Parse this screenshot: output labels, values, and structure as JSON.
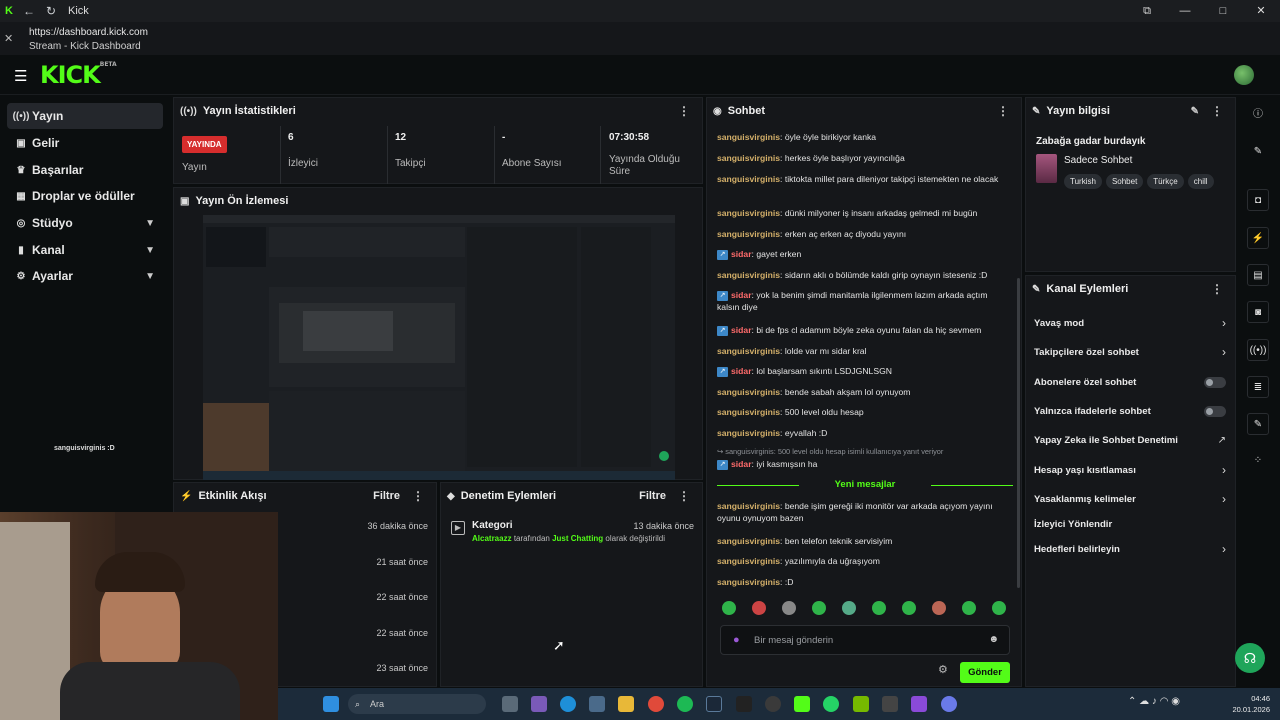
{
  "browser": {
    "tab_title": "Kick",
    "url": "https://dashboard.kick.com",
    "page_title": "Stream - Kick Dashboard"
  },
  "app": {
    "logo": "KICK",
    "logo_sup": "BETA"
  },
  "sidebar": {
    "items": [
      {
        "label": "Yayın",
        "icon": "broadcast-icon",
        "active": true
      },
      {
        "label": "Gelir",
        "icon": "money-icon"
      },
      {
        "label": "Başarılar",
        "icon": "trophy-icon"
      },
      {
        "label": "Droplar ve ödüller",
        "icon": "gift-icon"
      },
      {
        "label": "Stüdyo",
        "icon": "studio-icon",
        "expandable": true
      },
      {
        "label": "Kanal",
        "icon": "channel-icon",
        "expandable": true
      },
      {
        "label": "Ayarlar",
        "icon": "gear-icon",
        "expandable": true
      }
    ]
  },
  "overlay_text": "sanguisvirginis :D",
  "stats": {
    "title": "Yayın İstatistikleri",
    "live_badge": "YAYINDA",
    "live_label": "Yayın",
    "viewers_value": "6",
    "viewers_label": "İzleyici",
    "followers_value": "12",
    "followers_label": "Takipçi",
    "subs_value": "-",
    "subs_label": "Abone Sayısı",
    "uptime_value": "07:30:58",
    "uptime_label": "Yayında Olduğu Süre"
  },
  "preview": {
    "title": "Yayın Ön İzlemesi"
  },
  "activity": {
    "title": "Etkinlik Akışı",
    "filter": "Filtre",
    "times": [
      "36 dakika önce",
      "21 saat önce",
      "22 saat önce",
      "22 saat önce",
      "23 saat önce"
    ]
  },
  "moderation": {
    "title": "Denetim Eylemleri",
    "filter": "Filtre",
    "entry_title": "Kategori",
    "entry_time": "13 dakika önce",
    "entry_user": "Alcatraazz",
    "entry_mid": "tarafından",
    "entry_category": "Just Chatting",
    "entry_end": "olarak değiştirildi"
  },
  "chat": {
    "title": "Sohbet",
    "messages": [
      {
        "user": "sanguisvirginis",
        "text": "öyle öyle birikiyor kanka"
      },
      {
        "user": "sanguisvirginis",
        "text": "herkes öyle başlıyor yayıncılığa"
      },
      {
        "user": "sanguisvirginis",
        "text": "tiktokta millet para dileniyor takipçi istemekten ne olacak"
      },
      {
        "user": "sanguisvirginis",
        "text": "dünki milyoner iş insanı arkadaş gelmedi mi bugün"
      },
      {
        "user": "sanguisvirginis",
        "text": "erken aç erken aç diyodu yayını"
      },
      {
        "user": "sidar",
        "mod": true,
        "text": "gayet erken"
      },
      {
        "user": "sanguisvirginis",
        "text": "sidarın aklı o bölümde kaldı girip oynayın isteseniz :D"
      },
      {
        "user": "sidar",
        "mod": true,
        "text": "yok la benim şimdi manitamla ilgilenmem lazım arkada açtım kalsın diye"
      },
      {
        "user": "sidar",
        "mod": true,
        "text": "bi de fps cl adamım böyle zeka oyunu falan da hiç sevmem"
      },
      {
        "user": "sanguisvirginis",
        "text": "lolde var mı sidar kral"
      },
      {
        "user": "sidar",
        "mod": true,
        "text": "lol başlarsam sıkıntı LSDJGNLSGN"
      },
      {
        "user": "sanguisvirginis",
        "text": "bende sabah akşam lol oynuyom"
      },
      {
        "user": "sanguisvirginis",
        "text": "500 level oldu hesap"
      },
      {
        "user": "sanguisvirginis",
        "text": "eyvallah :D"
      }
    ],
    "reply_hint": "sanguisvirginis: 500 level oldu hesap isimli kullanıcıya yanıt veriyor",
    "reply_user": "sidar",
    "reply_text": "iyi kasmışsın ha",
    "new_messages_label": "Yeni mesajlar",
    "new_messages": [
      {
        "user": "sanguisvirginis",
        "text": "bende işim gereği iki monitör var arkada açıyom yayını oyunu oynuyom bazen"
      },
      {
        "user": "sanguisvirginis",
        "text": "ben telefon teknik servisiyim"
      },
      {
        "user": "sanguisvirginis",
        "text": "yazılımıyla da uğraşıyom"
      },
      {
        "user": "sanguisvirginis",
        "text": ":D"
      }
    ],
    "input_placeholder": "Bir mesaj gönderin",
    "send_label": "Gönder"
  },
  "stream_info": {
    "title": "Yayın bilgisi",
    "stream_title": "Zabağa gadar burdayık",
    "category": "Sadece Sohbet",
    "tags": [
      "Turkish",
      "Sohbet",
      "Türkçe",
      "chill"
    ]
  },
  "channel_actions": {
    "title": "Kanal Eylemleri",
    "items": [
      {
        "label": "Yavaş mod",
        "control": "chevron"
      },
      {
        "label": "Takipçilere özel sohbet",
        "control": "chevron"
      },
      {
        "label": "Abonelere özel sohbet",
        "control": "toggle"
      },
      {
        "label": "Yalnızca ifadelerle sohbet",
        "control": "toggle"
      },
      {
        "label": "Yapay Zeka ile Sohbet Denetimi",
        "control": "external"
      },
      {
        "label": "Hesap yaşı kısıtlaması",
        "control": "chevron"
      },
      {
        "label": "Yasaklanmış kelimeler",
        "control": "chevron"
      },
      {
        "label": "İzleyici Yönlendir",
        "control": "none"
      },
      {
        "label": "Hedefleri belirleyin",
        "control": "chevron"
      }
    ]
  },
  "taskbar": {
    "search_placeholder": "Ara",
    "time": "04:46",
    "date": "20.01.2026"
  },
  "colors": {
    "accent": "#53fc18",
    "live": "#d62d2d",
    "mod_name": "#ff6b6b",
    "user_name": "#d4b06a"
  }
}
